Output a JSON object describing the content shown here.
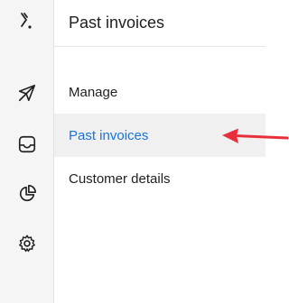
{
  "rail": {
    "icons": [
      "logo-icon",
      "send-icon",
      "inbox-icon",
      "chart-icon",
      "gear-icon"
    ]
  },
  "panel": {
    "title": "Past invoices",
    "menu": [
      {
        "label": "Manage",
        "active": false
      },
      {
        "label": "Past invoices",
        "active": true
      },
      {
        "label": "Customer details",
        "active": false
      }
    ]
  },
  "colors": {
    "accent": "#1a73d9",
    "annotation_arrow": "#e8303d"
  }
}
